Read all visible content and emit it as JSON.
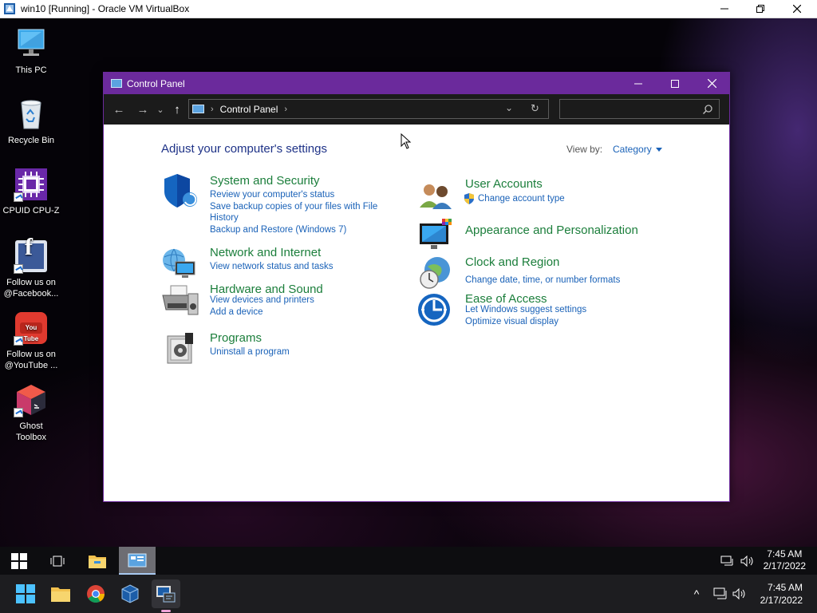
{
  "host_window": {
    "title": "win10 [Running] - Oracle VM VirtualBox",
    "controls": {
      "minimize": "─",
      "maximize": "❐",
      "close": "✕"
    }
  },
  "desktop": {
    "icons": [
      {
        "label_line1": "This PC",
        "label_line2": ""
      },
      {
        "label_line1": "Recycle Bin",
        "label_line2": ""
      },
      {
        "label_line1": "CPUID CPU-Z",
        "label_line2": ""
      },
      {
        "label_line1": "Follow us on",
        "label_line2": "@Facebook..."
      },
      {
        "label_line1": "Follow us on",
        "label_line2": "@YouTube ..."
      },
      {
        "label_line1": "Ghost",
        "label_line2": "Toolbox"
      }
    ],
    "youtube_logo_text": "You Tube",
    "facebook_logo_text": "f"
  },
  "window": {
    "title": "Control Panel",
    "controls": {
      "minimize": "─",
      "maximize": "☐",
      "close": "✕"
    },
    "nav": {
      "back": "←",
      "forward": "→",
      "recent": "⌄",
      "up": "↑",
      "refresh": "↻",
      "dropdown": "⌄",
      "search_icon": "⌕"
    },
    "address": {
      "sep1": "›",
      "crumb": "Control Panel",
      "sep2": "›"
    },
    "search_placeholder": ""
  },
  "content": {
    "heading": "Adjust your computer's settings",
    "view_by_label": "View by:",
    "view_by_value": "Category",
    "categories_left": [
      {
        "title": "System and Security",
        "links": [
          "Review your computer's status",
          "Save backup copies of your files with File",
          "History",
          "Backup and Restore (Windows 7)"
        ]
      },
      {
        "title": "Network and Internet",
        "links": [
          "View network status and tasks"
        ]
      },
      {
        "title": "Hardware and Sound",
        "links": [
          "View devices and printers",
          "Add a device"
        ]
      },
      {
        "title": "Programs",
        "links": [
          "Uninstall a program"
        ]
      }
    ],
    "categories_right": [
      {
        "title": "User Accounts",
        "links": [
          "Change account type"
        ]
      },
      {
        "title": "Appearance and Personalization",
        "links": []
      },
      {
        "title": "Clock and Region",
        "links": [
          "Change date, time, or number formats"
        ]
      },
      {
        "title": "Ease of Access",
        "links": [
          "Let Windows suggest settings",
          "Optimize visual display"
        ]
      }
    ]
  },
  "guest_taskbar": {
    "time": "7:45 AM",
    "date": "2/17/2022"
  },
  "host_taskbar": {
    "time": "7:45 AM",
    "date": "2/17/2022",
    "tray_chevron": "^"
  },
  "colors": {
    "accent_purple": "#6b2a9c",
    "link_blue": "#1a62b8",
    "category_green": "#1b7e3b",
    "heading_blue": "#1e3287"
  }
}
